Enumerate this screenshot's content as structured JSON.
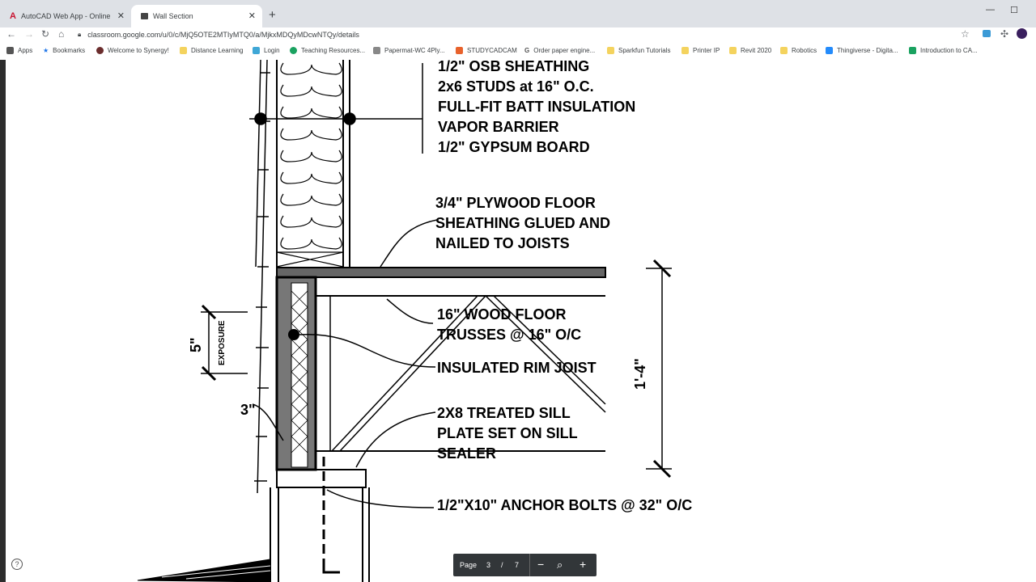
{
  "tabs": [
    {
      "title": "AutoCAD Web App - Online CAD"
    },
    {
      "title": "Wall Section"
    }
  ],
  "address": {
    "url": "classroom.google.com/u/0/c/MjQ5OTE2MTIyMTQ0/a/MjkxMDQyMDcwNTQy/details"
  },
  "bookmarks": [
    {
      "label": "Apps"
    },
    {
      "label": "Bookmarks"
    },
    {
      "label": "Welcome to Synergy!"
    },
    {
      "label": "Distance Learning"
    },
    {
      "label": "Login"
    },
    {
      "label": "Teaching Resources..."
    },
    {
      "label": "Papermat-WC 4Ply..."
    },
    {
      "label": "STUDYCADCAM"
    },
    {
      "label": "Order paper engine..."
    },
    {
      "label": "Sparkfun Tutorials"
    },
    {
      "label": "Printer IP"
    },
    {
      "label": "Revit 2020"
    },
    {
      "label": "Robotics"
    },
    {
      "label": "Thingiverse - Digita..."
    },
    {
      "label": "Introduction to CA..."
    }
  ],
  "drawing": {
    "wall_notes": [
      "1/2\" OSB SHEATHING",
      "2x6 STUDS at 16\" O.C.",
      "FULL-FIT BATT INSULATION",
      "VAPOR BARRIER",
      "1/2\" GYPSUM BOARD"
    ],
    "floor_sheathing": [
      "3/4\" PLYWOOD FLOOR",
      "SHEATHING GLUED AND",
      "NAILED TO JOISTS"
    ],
    "trusses": [
      "16\" WOOD FLOOR",
      "TRUSSES @ 16\" O/C"
    ],
    "rim_joist": "INSULATED RIM JOIST",
    "sill_plate": [
      "2X8 TREATED SILL",
      "PLATE SET ON SILL",
      "SEALER"
    ],
    "anchor": "1/2\"X10\" ANCHOR BOLTS @ 32\" O/C",
    "dim_height": "1'-4\"",
    "dim_exposure": "5\"",
    "exposure_label": "EXPOSURE",
    "dim_three": "3\""
  },
  "pager": {
    "label": "Page",
    "current": "3",
    "sep": "/",
    "total": "7"
  },
  "icons": {
    "star": "star-icon",
    "zoom": "zoom-icon"
  }
}
